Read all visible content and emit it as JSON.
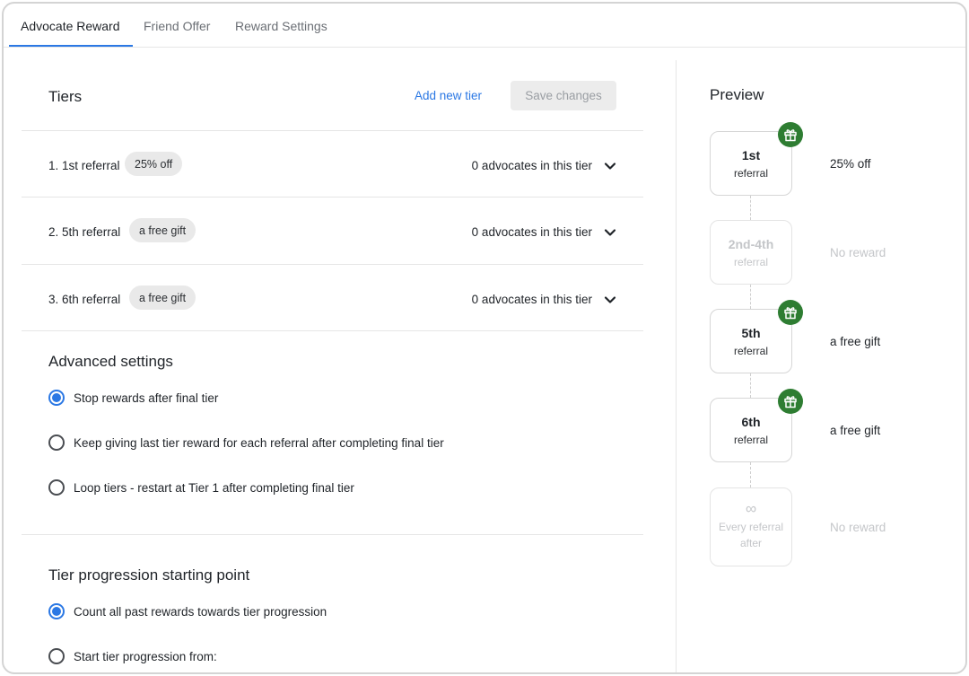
{
  "tabs": [
    {
      "label": "Advocate Reward",
      "active": true
    },
    {
      "label": "Friend Offer",
      "active": false
    },
    {
      "label": "Reward Settings",
      "active": false
    }
  ],
  "tiers_section": {
    "title": "Tiers",
    "add_tier_label": "Add new tier",
    "save_label": "Save changes"
  },
  "tiers": [
    {
      "label": "1. 1st referral",
      "reward": "25% off",
      "advocates": "0 advocates in this tier"
    },
    {
      "label": "2. 5th referral",
      "reward": "a free gift",
      "advocates": "0 advocates in this tier"
    },
    {
      "label": "3. 6th referral",
      "reward": "a free gift",
      "advocates": "0 advocates in this tier"
    }
  ],
  "advanced": {
    "title": "Advanced settings",
    "options": [
      {
        "label": "Stop rewards after final tier",
        "checked": true
      },
      {
        "label": "Keep giving last tier reward for each referral after completing final tier",
        "checked": false
      },
      {
        "label": "Loop tiers - restart at Tier 1 after completing final tier",
        "checked": false
      }
    ]
  },
  "progression": {
    "title": "Tier progression starting point",
    "options": [
      {
        "label": "Count all past rewards towards tier progression",
        "checked": true
      },
      {
        "label": "Start tier progression from:",
        "checked": false
      }
    ]
  },
  "preview": {
    "title": "Preview",
    "cards": [
      {
        "big": "1st",
        "small": "referral",
        "reward": "25% off",
        "has_gift": true,
        "dim": false
      },
      {
        "big": "2nd-4th",
        "small": "referral",
        "reward": "No reward",
        "has_gift": false,
        "dim": true
      },
      {
        "big": "5th",
        "small": "referral",
        "reward": "a free gift",
        "has_gift": true,
        "dim": false
      },
      {
        "big": "6th",
        "small": "referral",
        "reward": "a free gift",
        "has_gift": true,
        "dim": false
      },
      {
        "big": "∞",
        "small": "Every referral",
        "small2": "after",
        "reward": "No reward",
        "has_gift": false,
        "dim": true
      }
    ]
  },
  "colors": {
    "accent": "#2b78e4",
    "gift_badge": "#2e7d32",
    "muted_text": "#c4c6c9"
  },
  "icons": {
    "chevron": "chevron-down-icon",
    "gift": "gift-icon",
    "infinity": "infinity-icon"
  }
}
